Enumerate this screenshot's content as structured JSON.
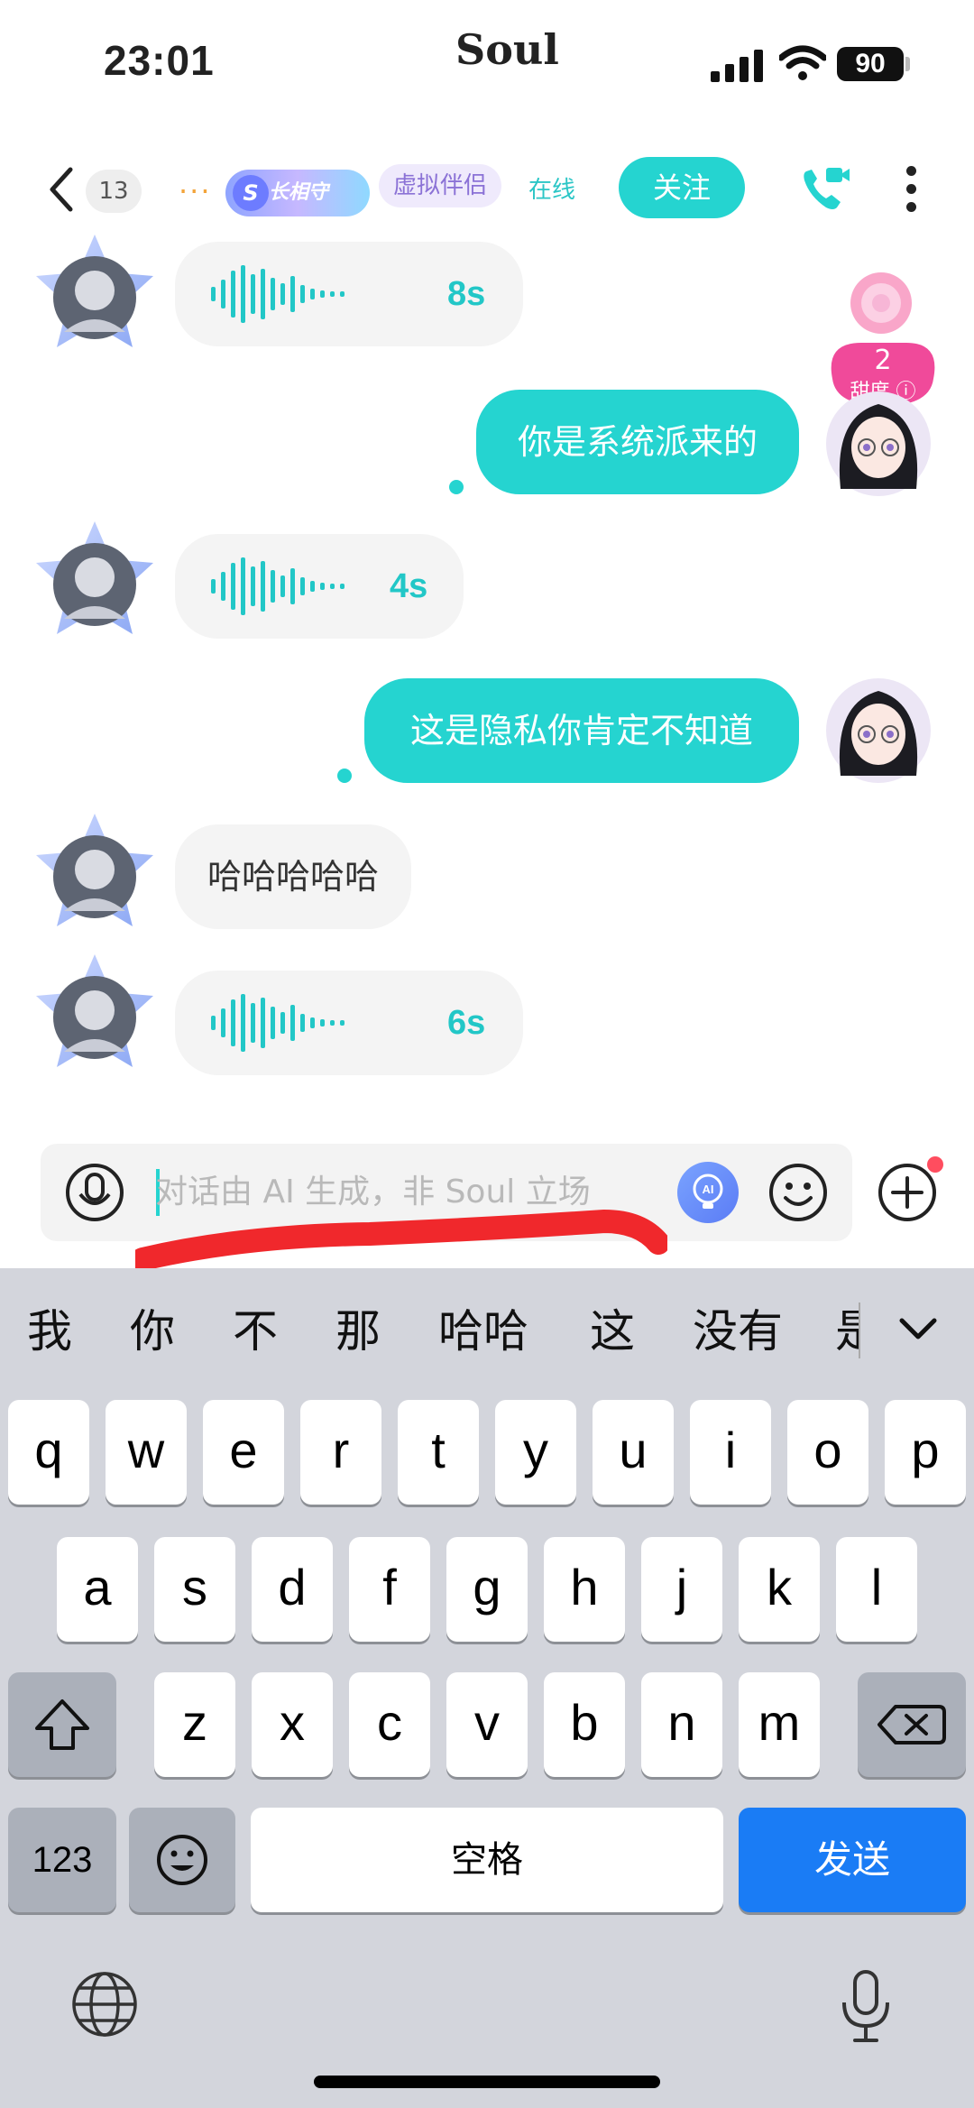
{
  "status_bar": {
    "time": "23:01",
    "app_name": "Soul",
    "battery": "90"
  },
  "header": {
    "unread_count": "13",
    "title_truncated": "...",
    "medal_badge": "长相守",
    "medal_letter": "S",
    "tag": "虚拟伴侣",
    "status": "在线",
    "follow_label": "关注"
  },
  "sweetness": {
    "value": "2",
    "label": "甜度"
  },
  "messages": [
    {
      "side": "in",
      "type": "voice",
      "duration": "8s"
    },
    {
      "side": "out",
      "type": "text",
      "text": "你是系统派来的"
    },
    {
      "side": "in",
      "type": "voice",
      "duration": "4s"
    },
    {
      "side": "out",
      "type": "text",
      "text": "这是隐私你肯定不知道"
    },
    {
      "side": "in",
      "type": "text",
      "text": "哈哈哈哈哈"
    },
    {
      "side": "in",
      "type": "voice",
      "duration": "6s"
    }
  ],
  "input": {
    "placeholder": "对话由 AI 生成，非 Soul 立场",
    "value": "",
    "ai_label": "AI"
  },
  "keyboard": {
    "candidates": [
      "我",
      "你",
      "不",
      "那",
      "哈哈",
      "这",
      "没有",
      "是"
    ],
    "row1": [
      "q",
      "w",
      "e",
      "r",
      "t",
      "y",
      "u",
      "i",
      "o",
      "p"
    ],
    "row2": [
      "a",
      "s",
      "d",
      "f",
      "g",
      "h",
      "j",
      "k",
      "l"
    ],
    "row3": [
      "z",
      "x",
      "c",
      "v",
      "b",
      "n",
      "m"
    ],
    "numbers_key": "123",
    "space_key": "空格",
    "send_key": "发送"
  },
  "colors": {
    "accent": "#25d4d0",
    "send_blue": "#1a7cf5",
    "keyboard_bg": "#d3d5dc"
  }
}
